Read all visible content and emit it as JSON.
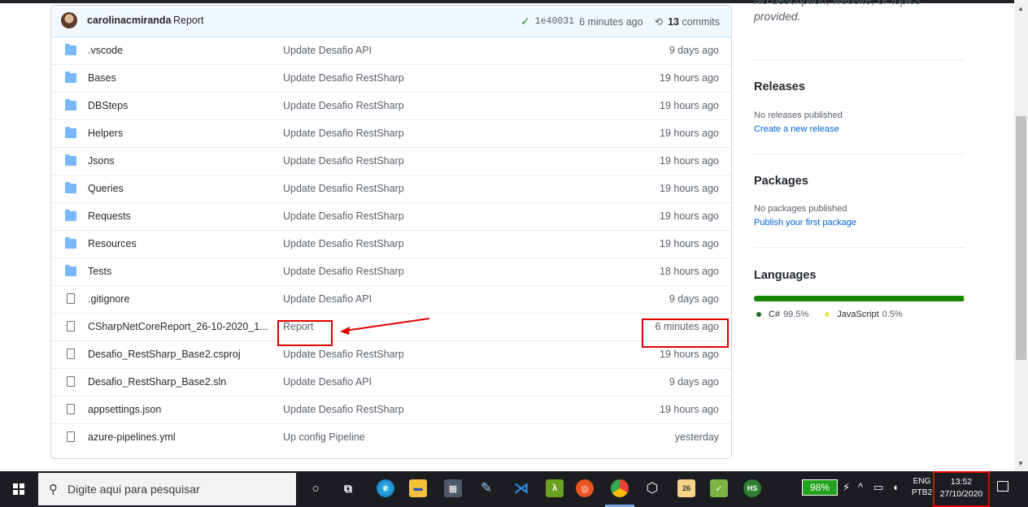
{
  "latest_commit": {
    "user": "carolinacmiranda",
    "message": "Report",
    "sha": "1e40031",
    "age": "6 minutes ago",
    "commits_count": "13",
    "commits_label": "commits"
  },
  "files": [
    {
      "type": "folder",
      "name": ".vscode",
      "message": "Update Desafio API",
      "age": "9 days ago"
    },
    {
      "type": "folder",
      "name": "Bases",
      "message": "Update Desafio RestSharp",
      "age": "19 hours ago"
    },
    {
      "type": "folder",
      "name": "DBSteps",
      "message": "Update Desafio RestSharp",
      "age": "19 hours ago"
    },
    {
      "type": "folder",
      "name": "Helpers",
      "message": "Update Desafio RestSharp",
      "age": "19 hours ago"
    },
    {
      "type": "folder",
      "name": "Jsons",
      "message": "Update Desafio RestSharp",
      "age": "19 hours ago"
    },
    {
      "type": "folder",
      "name": "Queries",
      "message": "Update Desafio RestSharp",
      "age": "19 hours ago"
    },
    {
      "type": "folder",
      "name": "Requests",
      "message": "Update Desafio RestSharp",
      "age": "19 hours ago"
    },
    {
      "type": "folder",
      "name": "Resources",
      "message": "Update Desafio RestSharp",
      "age": "19 hours ago"
    },
    {
      "type": "folder",
      "name": "Tests",
      "message": "Update Desafio RestSharp",
      "age": "18 hours ago"
    },
    {
      "type": "file",
      "name": ".gitignore",
      "message": "Update Desafio API",
      "age": "9 days ago"
    },
    {
      "type": "file",
      "name": "CSharpNetCoreReport_26-10-2020_1...",
      "message": "Report",
      "age": "6 minutes ago"
    },
    {
      "type": "file",
      "name": "Desafio_RestSharp_Base2.csproj",
      "message": "Update Desafio RestSharp",
      "age": "19 hours ago"
    },
    {
      "type": "file",
      "name": "Desafio_RestSharp_Base2.sln",
      "message": "Update Desafio API",
      "age": "9 days ago"
    },
    {
      "type": "file",
      "name": "appsettings.json",
      "message": "Update Desafio RestSharp",
      "age": "19 hours ago"
    },
    {
      "type": "file",
      "name": "azure-pipelines.yml",
      "message": "Up config Pipeline",
      "age": "yesterday"
    }
  ],
  "sidebar": {
    "description_line1": "No description, website, or topics",
    "description_line2": "provided.",
    "releases": {
      "title": "Releases",
      "status": "No releases published",
      "link": "Create a new release"
    },
    "packages": {
      "title": "Packages",
      "status": "No packages published",
      "link": "Publish your first package"
    },
    "languages": {
      "title": "Languages",
      "items": [
        {
          "name": "C#",
          "percent": "99.5%",
          "share": 99.5,
          "color": "#178600"
        },
        {
          "name": "JavaScript",
          "percent": "0.5%",
          "share": 0.5,
          "color": "#f1e05a"
        }
      ]
    }
  },
  "taskbar": {
    "search_placeholder": "Digite aqui para pesquisar",
    "battery": "98%",
    "lang_top": "ENG",
    "lang_bottom": "PTB2",
    "time": "13:52",
    "date": "27/10/2020"
  }
}
